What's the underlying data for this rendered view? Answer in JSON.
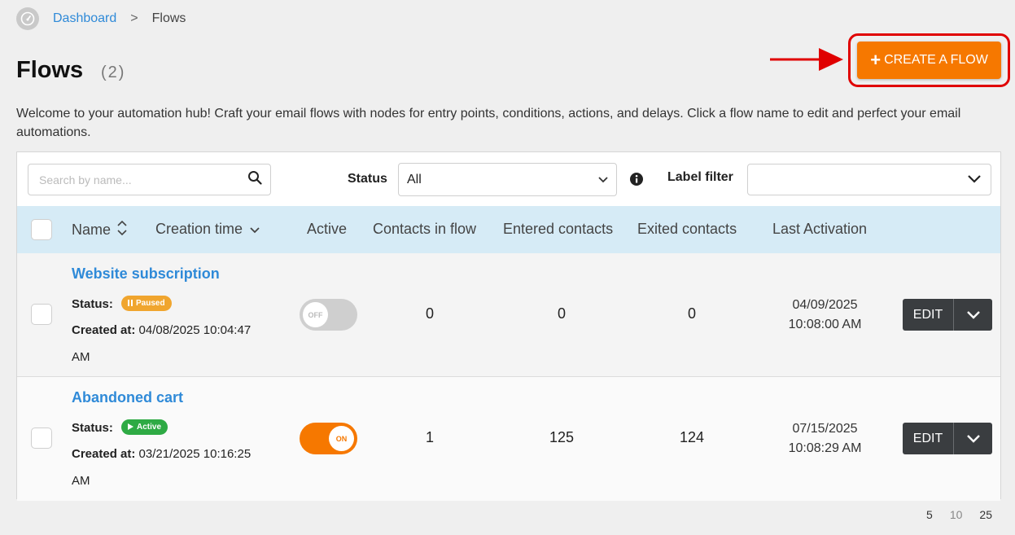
{
  "breadcrumb": {
    "home_icon": "dashboard-gauge-icon",
    "dashboard": "Dashboard",
    "separator": ">",
    "current": "Flows"
  },
  "page": {
    "title": "Flows",
    "count": "(2)"
  },
  "create_button": {
    "plus": "+",
    "label": "CREATE A FLOW"
  },
  "intro": "Welcome to your automation hub! Craft your email flows with nodes for entry points, conditions, actions, and delays. Click a flow name to edit and perfect your email automations.",
  "filters": {
    "search_placeholder": "Search by name...",
    "status_label": "Status",
    "status_value": "All",
    "label_filter_label": "Label filter",
    "label_filter_value": ""
  },
  "table": {
    "headers": {
      "name": "Name",
      "creation_time": "Creation time",
      "active": "Active",
      "contacts_in_flow": "Contacts in flow",
      "entered_contacts": "Entered contacts",
      "exited_contacts": "Exited contacts",
      "last_activation": "Last Activation"
    },
    "rows": [
      {
        "name": "Website subscription",
        "status_label": "Status:",
        "status": "Paused",
        "created_label": "Created at:",
        "created_line1": "04/08/2025 10:04:47",
        "created_line2": "AM",
        "toggle": "OFF",
        "contacts_in_flow": "0",
        "entered_contacts": "0",
        "exited_contacts": "0",
        "last_activation_date": "04/09/2025",
        "last_activation_time": "10:08:00 AM",
        "edit": "EDIT"
      },
      {
        "name": "Abandoned cart",
        "status_label": "Status:",
        "status": "Active",
        "created_label": "Created at:",
        "created_line1": "03/21/2025 10:16:25",
        "created_line2": "AM",
        "toggle": "ON",
        "contacts_in_flow": "1",
        "entered_contacts": "125",
        "exited_contacts": "124",
        "last_activation_date": "07/15/2025",
        "last_activation_time": "10:08:29 AM",
        "edit": "EDIT"
      }
    ]
  },
  "pagination": [
    "5",
    "10",
    "25"
  ],
  "colors": {
    "accent": "#f67800",
    "link": "#2f8ad8",
    "header_bg": "#d6ebf6",
    "paused": "#f0a52e",
    "active": "#2eaa44",
    "annotation": "#e00000"
  }
}
